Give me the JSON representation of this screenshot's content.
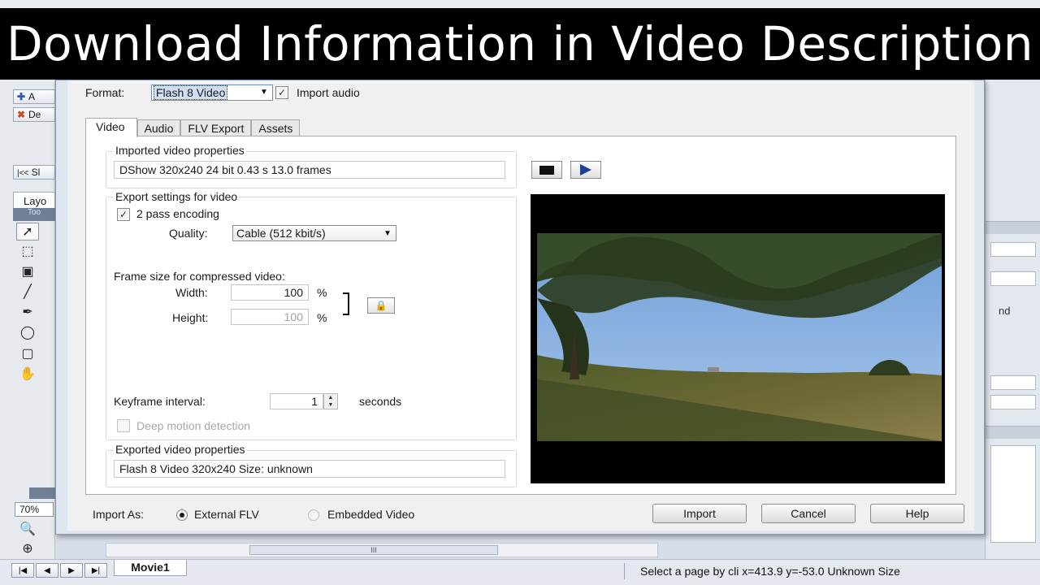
{
  "banner": {
    "text": "Download Information in Video Description"
  },
  "dialog": {
    "format_label": "Format:",
    "format_value": "Flash 8 Video",
    "import_audio_label": "Import audio",
    "import_audio_checked": true,
    "tabs": [
      {
        "label": "Video",
        "active": true
      },
      {
        "label": "Audio",
        "active": false
      },
      {
        "label": "FLV Export",
        "active": false
      },
      {
        "label": "Assets",
        "active": false
      }
    ],
    "imported_props": {
      "title": "Imported video properties",
      "value": "DShow 320x240 24 bit 0.43 s 13.0 frames"
    },
    "export_settings": {
      "title": "Export settings for video",
      "two_pass_label": "2 pass encoding",
      "two_pass_checked": true,
      "quality_label": "Quality:",
      "quality_value": "Cable (512 kbit/s)",
      "frame_size_label": "Frame size for compressed video:",
      "width_label": "Width:",
      "width_value": "100",
      "height_label": "Height:",
      "height_value": "100",
      "percent": "%",
      "keyframe_label": "Keyframe interval:",
      "keyframe_value": "1",
      "seconds_label": "seconds",
      "deep_motion_label": "Deep motion detection",
      "deep_motion_checked": false
    },
    "exported_props": {
      "title": "Exported video properties",
      "value": "Flash 8 Video 320x240 Size: unknown"
    },
    "import_as_label": "Import As:",
    "import_as_options": [
      "External FLV",
      "Embedded Video"
    ],
    "import_as_selected": "External FLV",
    "buttons": {
      "import": "Import",
      "cancel": "Cancel",
      "help": "Help"
    }
  },
  "background_app": {
    "left_buttons": [
      "A",
      "De"
    ],
    "scroll_prev": "|<<",
    "scroll_label": "Sl",
    "layer_tab": "Layo",
    "tools_header": "Too",
    "zoom": "70%",
    "right_text": "nd",
    "movie_tab": "Movie1",
    "status": "Select a page by cli  x=413.9 y=-53.0  Unknown Size",
    "scroll_thumb": "III"
  },
  "colors": {
    "banner_bg": "#000000",
    "banner_text": "#ffffff",
    "dialog_bg": "#f0f0f0",
    "play_arrow": "#1c3f9c"
  }
}
